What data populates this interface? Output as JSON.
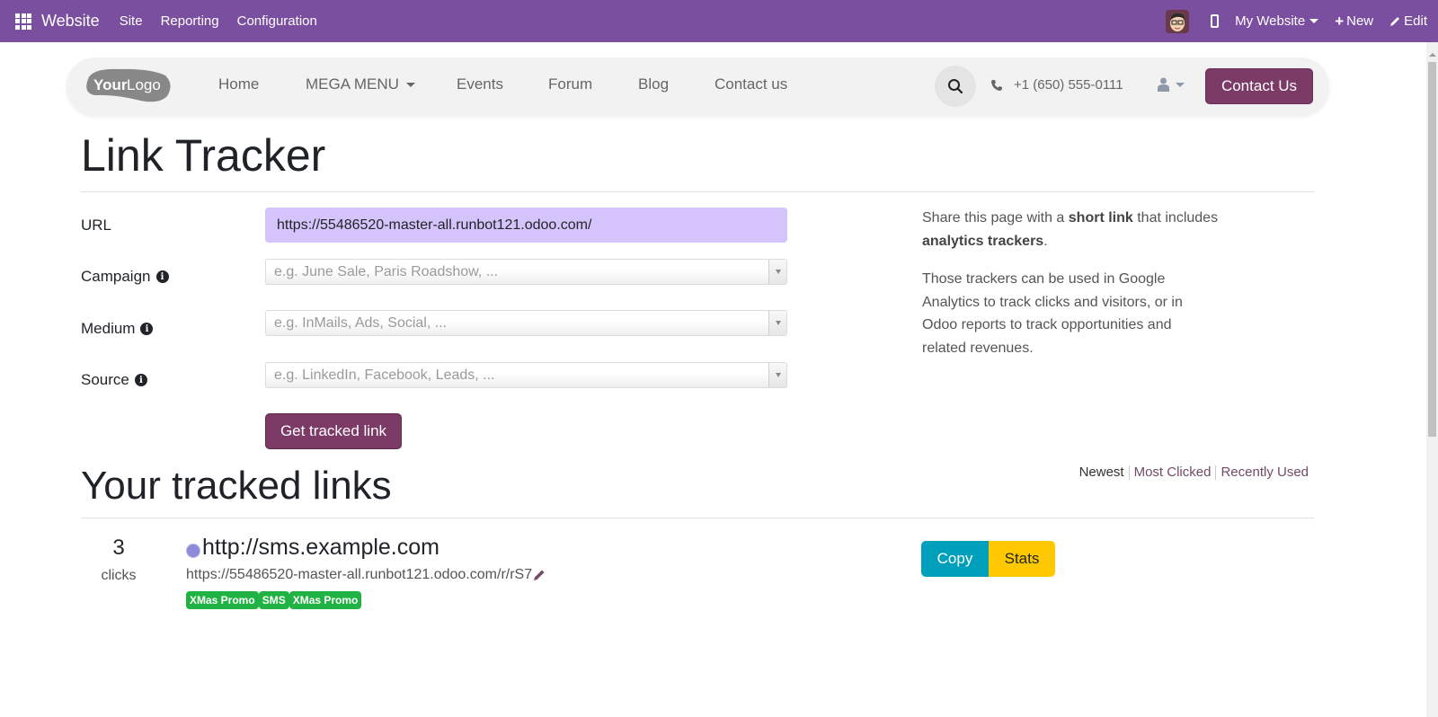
{
  "topbar": {
    "app_name": "Website",
    "menus": [
      "Site",
      "Reporting",
      "Configuration"
    ],
    "website_selector": "My Website",
    "new_label": "New",
    "edit_label": "Edit",
    "bg_color": "#7a4f9f"
  },
  "site_header": {
    "logo_text_bold": "Your",
    "logo_text_light": "Logo",
    "nav": [
      "Home",
      "MEGA MENU",
      "Events",
      "Forum",
      "Blog",
      "Contact us"
    ],
    "phone": "+1 (650) 555-0111",
    "contact_button": "Contact Us"
  },
  "page": {
    "title": "Link Tracker",
    "form": {
      "url_label": "URL",
      "url_value": "https://55486520-master-all.runbot121.odoo.com/",
      "campaign_label": "Campaign",
      "campaign_placeholder": "e.g. June Sale, Paris Roadshow, ...",
      "medium_label": "Medium",
      "medium_placeholder": "e.g. InMails, Ads, Social, ...",
      "source_label": "Source",
      "source_placeholder": "e.g. LinkedIn, Facebook, Leads, ...",
      "submit_label": "Get tracked link"
    },
    "sidebar": {
      "p1_a": "Share this page with a ",
      "p1_b": "short link",
      "p1_c": " that includes ",
      "p1_d": "analytics trackers",
      "p1_e": ".",
      "p2": "Those trackers can be used in Google Analytics to track clicks and visitors, or in Odoo reports to track opportunities and related revenues."
    },
    "tracked": {
      "title": "Your tracked links",
      "sort_options": [
        "Newest",
        "Most Clicked",
        "Recently Used"
      ],
      "links": [
        {
          "clicks": "3",
          "clicks_label": "clicks",
          "title": "http://sms.example.com",
          "short_url": "https://55486520-master-all.runbot121.odoo.com/r/rS7",
          "tags": [
            "XMas Promo",
            "SMS",
            "XMas Promo"
          ],
          "copy_label": "Copy",
          "stats_label": "Stats"
        }
      ]
    }
  }
}
